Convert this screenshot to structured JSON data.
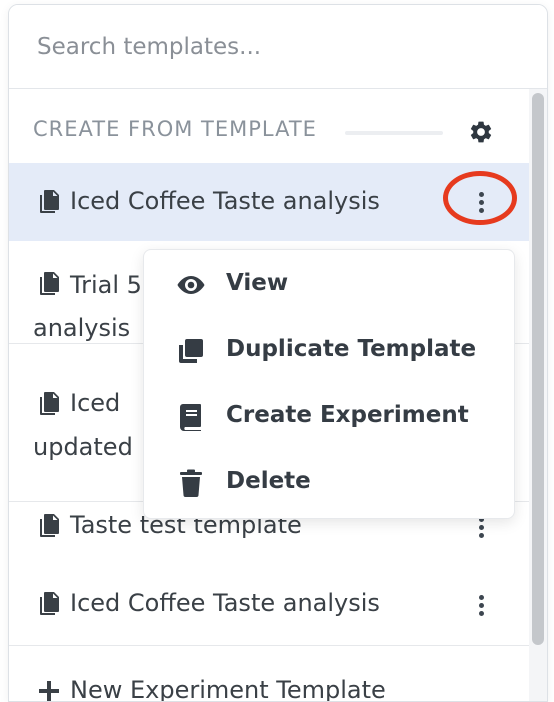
{
  "search": {
    "placeholder": "Search templates..."
  },
  "section": {
    "title": "CREATE FROM TEMPLATE"
  },
  "templates": [
    {
      "label": "Iced Coffee Taste analysis"
    },
    {
      "label": "Trial 5",
      "label_line2": "analysis"
    },
    {
      "label": "Iced",
      "label_line2": "updated"
    },
    {
      "label": "Taste test template"
    },
    {
      "label": "Iced Coffee Taste analysis"
    }
  ],
  "footer": {
    "new_template_label": "New Experiment Template"
  },
  "context_menu": {
    "items": [
      {
        "label": "View",
        "icon": "eye-icon"
      },
      {
        "label": "Duplicate Template",
        "icon": "duplicate-icon"
      },
      {
        "label": "Create Experiment",
        "icon": "book-icon"
      },
      {
        "label": "Delete",
        "icon": "trash-icon"
      }
    ]
  },
  "colors": {
    "selected_row": "#e4ebf8",
    "highlight_ring": "#e63a1e",
    "icon": "#3d4650"
  }
}
